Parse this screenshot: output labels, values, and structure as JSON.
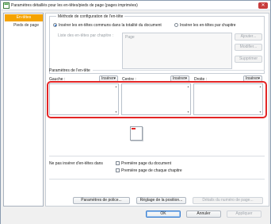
{
  "window": {
    "title": "Paramètres détaillés pour les en-têtes/pieds de page (pages imprimées)",
    "close_glyph": "✕"
  },
  "nav": {
    "items": [
      {
        "label": "En-têtes",
        "selected": true
      },
      {
        "label": "Pieds de page",
        "selected": false
      }
    ]
  },
  "config_group": {
    "title": "Méthode de configuration de l'en-tête",
    "radio_common_label": "Insérer les en-têtes communs dans la totalité du document",
    "radio_per_chapter_label": "Insérer les en-têtes par chapitre",
    "chapter_list_label": "Liste des en-têtes par chapitre :",
    "list_item": "Page",
    "add_label": "Ajouter...",
    "modify_label": "Modifier...",
    "delete_label": "Supprimer"
  },
  "header_params": {
    "title": "Paramètres de l'en-tête",
    "left_label": "Gauche :",
    "center_label": "Centre :",
    "right_label": "Droite :",
    "insert_label": "Insérer"
  },
  "no_chapter": {
    "label": "Ne pas insérer d'en-têtes dans",
    "first_doc_page": "Première page du document",
    "first_chapter_page": "Première page de chaque chapitre"
  },
  "actions": {
    "font_label": "Paramètres de police...",
    "position_label": "Réglage de la position...",
    "page_number_label": "Détails du numéro de page..."
  },
  "footer": {
    "ok_label": "OK",
    "cancel_label": "Annuler",
    "apply_label": "Appliquer"
  }
}
